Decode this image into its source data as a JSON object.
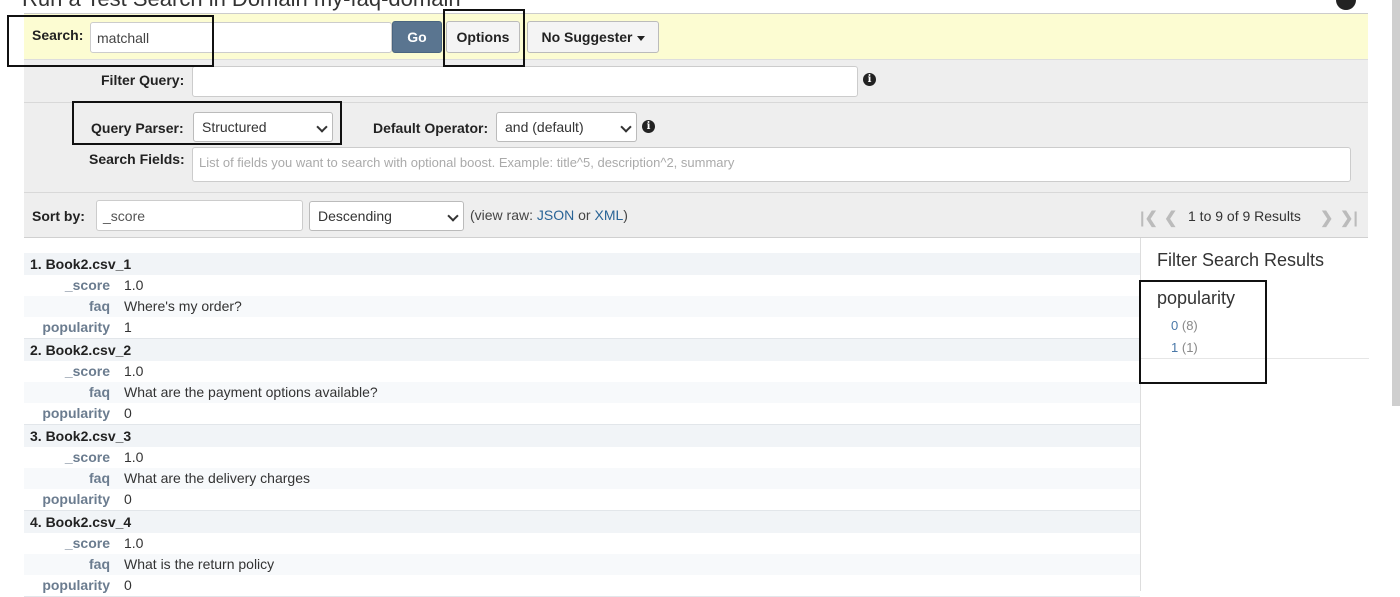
{
  "page": {
    "title": "Run a Test Search in Domain my-faq-domain"
  },
  "search": {
    "label": "Search:",
    "value": "matchall",
    "go_label": "Go",
    "options_label": "Options",
    "suggester_label": "No Suggester"
  },
  "filter": {
    "label": "Filter Query:",
    "value": ""
  },
  "parser": {
    "label": "Query Parser:",
    "selected": "Structured",
    "operator_label": "Default Operator:",
    "operator_selected": "and (default)",
    "fields_label": "Search Fields:",
    "fields_placeholder": "List of fields you want to search with optional boost. Example: title^5, description^2, summary"
  },
  "sort": {
    "label": "Sort by:",
    "field": "_score",
    "direction": "Descending",
    "view_raw_prefix": "(view raw:",
    "json_link": "JSON",
    "or_text": "or",
    "xml_link": "XML",
    "view_raw_suffix": ")"
  },
  "pager": {
    "summary": "1 to 9 of 9 Results"
  },
  "results": [
    {
      "title": "1.  Book2.csv_1",
      "score": "1.0",
      "faq": "Where's my order?",
      "popularity": "1"
    },
    {
      "title": "2.  Book2.csv_2",
      "score": "1.0",
      "faq": "What are the payment options available?",
      "popularity": "0"
    },
    {
      "title": "3.  Book2.csv_3",
      "score": "1.0",
      "faq": "What are the delivery charges",
      "popularity": "0"
    },
    {
      "title": "4.  Book2.csv_4",
      "score": "1.0",
      "faq": "What is the return policy",
      "popularity": "0"
    }
  ],
  "field_labels": {
    "score": "_score",
    "faq": "faq",
    "popularity": "popularity"
  },
  "sidebar": {
    "title": "Filter Search Results",
    "facet_title": "popularity",
    "facets": [
      {
        "value": "0",
        "count": "(8)"
      },
      {
        "value": "1",
        "count": "(1)"
      }
    ]
  }
}
